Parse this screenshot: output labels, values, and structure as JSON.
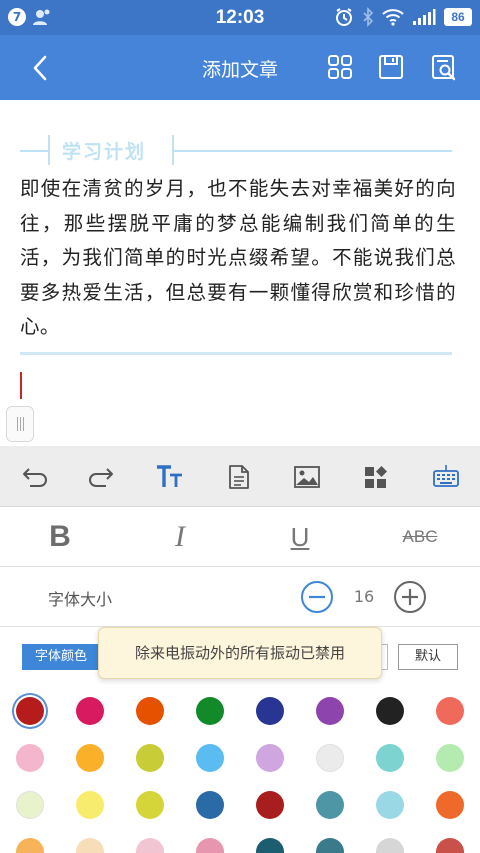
{
  "status_bar": {
    "notification_count": "7",
    "time": "12:03",
    "battery": "86",
    "icons": [
      "notification-badge-icon",
      "contact-icon",
      "alarm-icon",
      "bluetooth-icon",
      "wifi-icon",
      "signal-icon",
      "battery-icon"
    ]
  },
  "toolbar": {
    "title": "添加文章",
    "icons": [
      "back-arrow-icon",
      "grid-icon",
      "save-icon",
      "preview-icon"
    ],
    "background": "#4584d8"
  },
  "editor": {
    "section_title": "学习计划",
    "body": "即使在清贫的岁月，也不能失去对幸福美好的向往，那些摆脱平庸的梦总能编制我们简单的生活，为我们简单的时光点缀希望。不能说我们总要多热爱生活，但总要有一颗懂得欣赏和珍惜的心。",
    "accent_color": "#bfe3f4",
    "cursor_color": "#c62828"
  },
  "format_toolbar": {
    "icons": [
      "undo-icon",
      "redo-icon",
      "text-format-icon",
      "document-icon",
      "image-icon",
      "widgets-icon",
      "keyboard-icon"
    ]
  },
  "text_style": {
    "bold": "B",
    "italic": "I",
    "underline": "U",
    "strikethrough": "ABC"
  },
  "font_size": {
    "label": "字体大小",
    "value": "16"
  },
  "color_tabs": {
    "font_color": "字体颜色",
    "default": "默认",
    "active_color": "#3d86d8"
  },
  "toast": {
    "message": "除来电振动外的所有振动已禁用"
  },
  "palette": {
    "selected_index": 0,
    "colors": [
      "#b71c1c",
      "#d81b60",
      "#e65100",
      "#138a2a",
      "#283593",
      "#8e44ad",
      "#222222",
      "#ef6a5a",
      "#f4b6cc",
      "#fbb02a",
      "#c8cc36",
      "#5bbcf2",
      "#cfa6df",
      "#ebebeb",
      "#7dd3cf",
      "#b5ebb0",
      "#e8f3cc",
      "#f8ec6e",
      "#d5d53a",
      "#2a6aa6",
      "#a81d1d",
      "#4e95a5",
      "#9bd8e6",
      "#ef6a2a",
      "#f6b35a",
      "#f7ddb8",
      "#f1c6d2",
      "#e896b0",
      "#1c5e70",
      "#3b7a8a",
      "#d6d6d6",
      "#c9514a"
    ]
  }
}
